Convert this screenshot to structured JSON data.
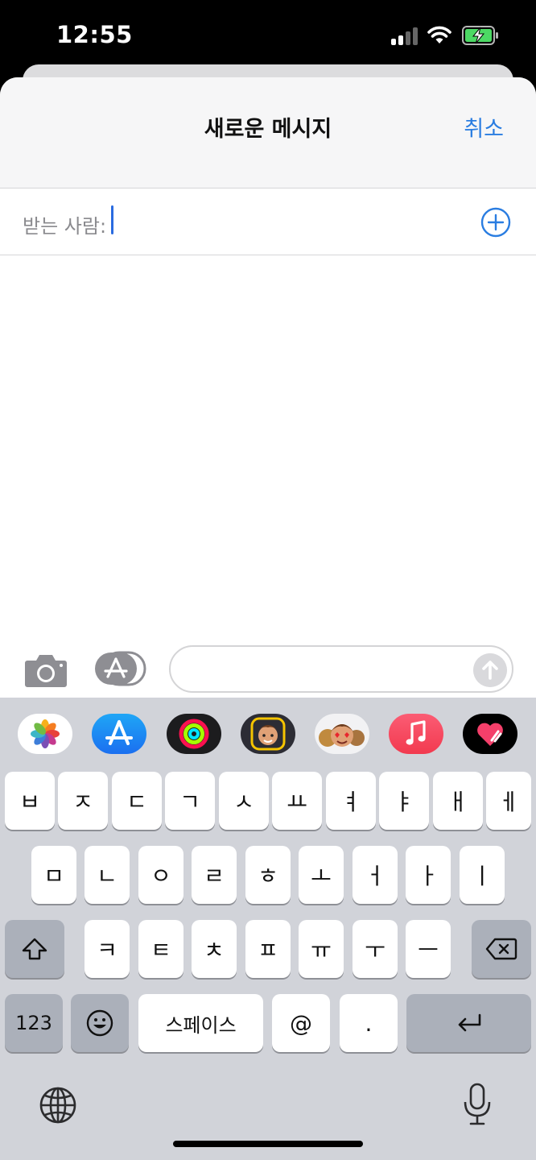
{
  "status_bar": {
    "time": "12:55"
  },
  "header": {
    "title": "새로운 메시지",
    "cancel_label": "취소"
  },
  "recipient": {
    "label": "받는 사람:"
  },
  "apps": [
    {
      "name": "photos-app-icon"
    },
    {
      "name": "app-store-app-icon"
    },
    {
      "name": "activity-app-icon"
    },
    {
      "name": "memoji-app-icon"
    },
    {
      "name": "memoji-stickers-app-icon"
    },
    {
      "name": "music-app-icon"
    },
    {
      "name": "digital-touch-app-icon"
    }
  ],
  "keyboard": {
    "row1": [
      "ㅂ",
      "ㅈ",
      "ㄷ",
      "ㄱ",
      "ㅅ",
      "ㅛ",
      "ㅕ",
      "ㅑ",
      "ㅐ",
      "ㅔ"
    ],
    "row2": [
      "ㅁ",
      "ㄴ",
      "ㅇ",
      "ㄹ",
      "ㅎ",
      "ㅗ",
      "ㅓ",
      "ㅏ",
      "ㅣ"
    ],
    "row3": [
      "ㅋ",
      "ㅌ",
      "ㅊ",
      "ㅍ",
      "ㅠ",
      "ㅜ",
      "ㅡ"
    ],
    "numbers_label": "123",
    "space_label": "스페이스",
    "at_label": "@",
    "period_label": "."
  },
  "colors": {
    "accent": "#2a7de1",
    "keyboard_bg": "#d1d3d9"
  }
}
